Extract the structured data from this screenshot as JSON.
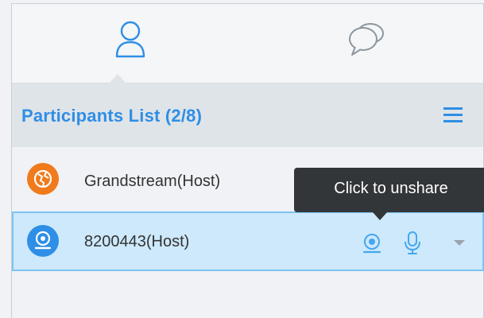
{
  "tabs": [
    {
      "icon": "person-icon",
      "active": true
    },
    {
      "icon": "chat-bubbles-icon",
      "active": false
    }
  ],
  "header": {
    "title": "Participants List (2/8)",
    "menu_icon": "hamburger-icon"
  },
  "participants": [
    {
      "name": "Grandstream(Host)",
      "avatar_icon": "globe-icon",
      "avatar_color": "#f07a1c"
    },
    {
      "name": "8200443(Host)",
      "avatar_icon": "screen-share-icon",
      "avatar_color": "#2f8ee5",
      "selected": true
    }
  ],
  "tooltip": {
    "text": "Click to unshare"
  },
  "colors": {
    "accent": "#2f8ee5",
    "selected_bg": "#cde9fb",
    "selected_border": "#7cc4f2",
    "tooltip_bg": "#333638"
  }
}
